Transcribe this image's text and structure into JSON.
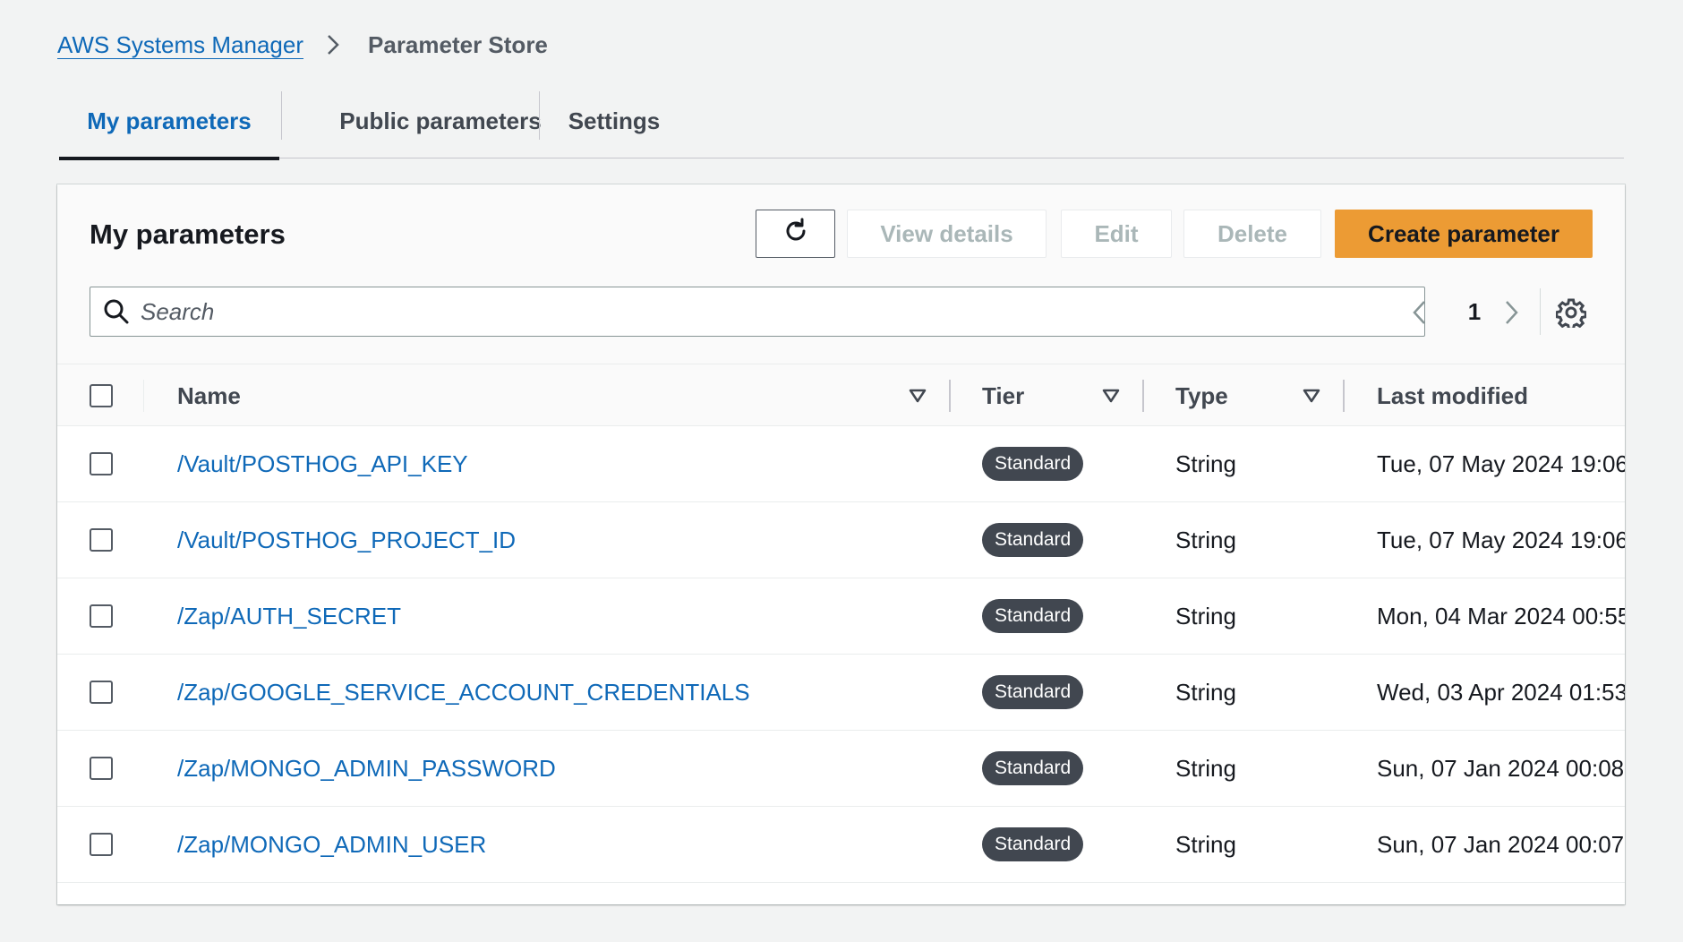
{
  "breadcrumb": {
    "parent": "AWS Systems Manager",
    "current": "Parameter Store"
  },
  "tabs": [
    {
      "label": "My parameters",
      "active": true
    },
    {
      "label": "Public parameters",
      "active": false
    },
    {
      "label": "Settings",
      "active": false
    }
  ],
  "panel": {
    "title": "My parameters",
    "buttons": {
      "view_details": "View details",
      "edit": "Edit",
      "delete": "Delete",
      "create": "Create parameter"
    },
    "search_placeholder": "Search",
    "page": "1"
  },
  "table": {
    "headers": {
      "name": "Name",
      "tier": "Tier",
      "type": "Type",
      "last_modified": "Last modified"
    },
    "rows": [
      {
        "name": "/Vault/POSTHOG_API_KEY",
        "tier": "Standard",
        "type": "String",
        "last_modified": "Tue, 07 May 2024 19:06"
      },
      {
        "name": "/Vault/POSTHOG_PROJECT_ID",
        "tier": "Standard",
        "type": "String",
        "last_modified": "Tue, 07 May 2024 19:06"
      },
      {
        "name": "/Zap/AUTH_SECRET",
        "tier": "Standard",
        "type": "String",
        "last_modified": "Mon, 04 Mar 2024 00:55"
      },
      {
        "name": "/Zap/GOOGLE_SERVICE_ACCOUNT_CREDENTIALS",
        "tier": "Standard",
        "type": "String",
        "last_modified": "Wed, 03 Apr 2024 01:53"
      },
      {
        "name": "/Zap/MONGO_ADMIN_PASSWORD",
        "tier": "Standard",
        "type": "String",
        "last_modified": "Sun, 07 Jan 2024 00:08:"
      },
      {
        "name": "/Zap/MONGO_ADMIN_USER",
        "tier": "Standard",
        "type": "String",
        "last_modified": "Sun, 07 Jan 2024 00:07:"
      }
    ]
  },
  "colors": {
    "link": "#0f69b8",
    "primary_button": "#ec9b34",
    "badge": "#414750",
    "background": "#f2f3f3"
  }
}
